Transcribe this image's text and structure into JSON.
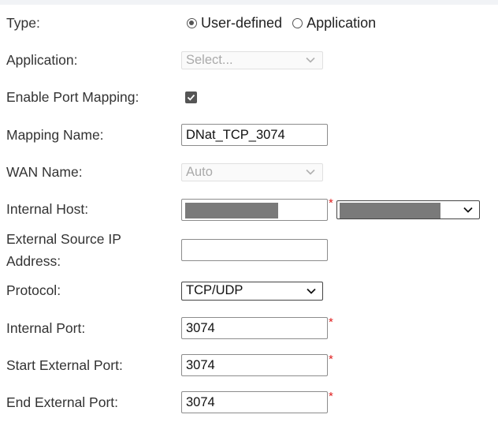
{
  "colors": {
    "label_text": "#333333",
    "required_mark": "#e02020",
    "control_border": "#8c8c8c",
    "disabled_text": "#aaaaaa"
  },
  "form": {
    "type": {
      "label": "Type:",
      "options": [
        {
          "label": "User-defined",
          "selected": true
        },
        {
          "label": "Application",
          "selected": false
        }
      ]
    },
    "application": {
      "label": "Application:",
      "value": "Select...",
      "disabled": true
    },
    "enable_port_mapping": {
      "label": "Enable Port Mapping:",
      "checked": true
    },
    "mapping_name": {
      "label": "Mapping Name:",
      "value": "DNat_TCP_3074"
    },
    "wan_name": {
      "label": "WAN Name:",
      "value": "Auto",
      "disabled": true
    },
    "internal_host": {
      "label": "Internal Host:",
      "required_mark": "*"
    },
    "external_source_ip": {
      "label": "External Source IP Address:",
      "value": ""
    },
    "protocol": {
      "label": "Protocol:",
      "value": "TCP/UDP"
    },
    "internal_port": {
      "label": "Internal Port:",
      "value": "3074",
      "required_mark": "*"
    },
    "start_external_port": {
      "label": "Start External Port:",
      "value": "3074",
      "required_mark": "*"
    },
    "end_external_port": {
      "label": "End External Port:",
      "value": "3074",
      "required_mark": "*"
    }
  }
}
